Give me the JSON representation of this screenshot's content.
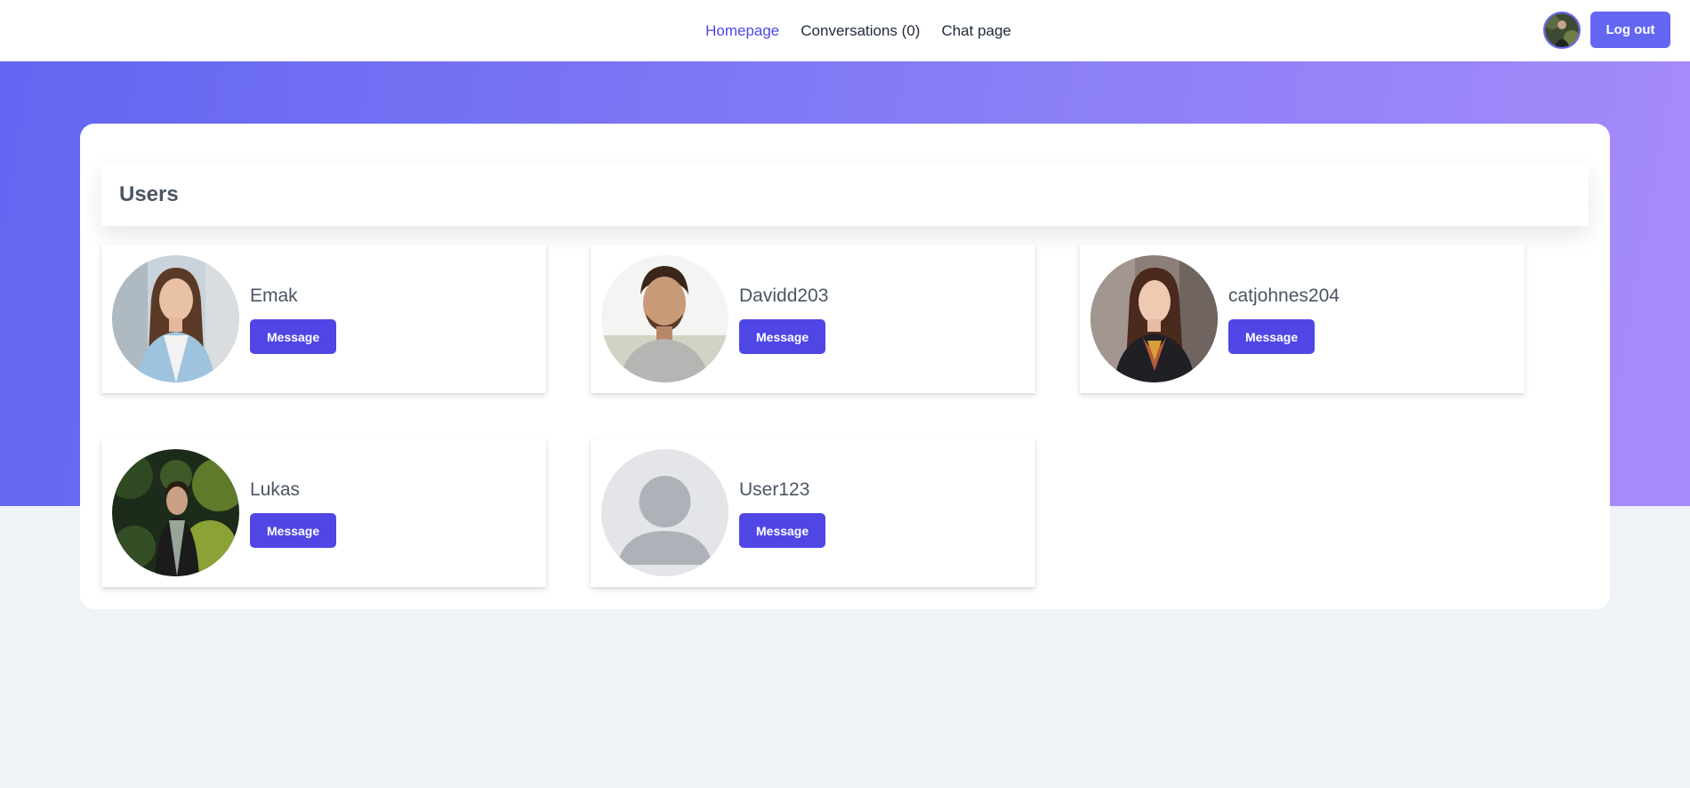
{
  "nav": {
    "items": [
      {
        "label": "Homepage",
        "active": true
      },
      {
        "label": "Conversations (0)",
        "active": false
      },
      {
        "label": "Chat page",
        "active": false
      }
    ],
    "logout_label": "Log out"
  },
  "colors": {
    "accent": "#4f46e5",
    "gradient_start": "#6366f1",
    "gradient_end": "#a78bfa"
  },
  "users": {
    "title": "Users",
    "list": [
      {
        "name": "Emak",
        "button": "Message",
        "avatar": "photo-woman-long-hair"
      },
      {
        "name": "Davidd203",
        "button": "Message",
        "avatar": "photo-smiling-man"
      },
      {
        "name": "catjohnes204",
        "button": "Message",
        "avatar": "photo-woman-scarf"
      },
      {
        "name": "Lukas",
        "button": "Message",
        "avatar": "photo-man-in-foliage"
      },
      {
        "name": "User123",
        "button": "Message",
        "avatar": "default-avatar-icon"
      }
    ]
  }
}
